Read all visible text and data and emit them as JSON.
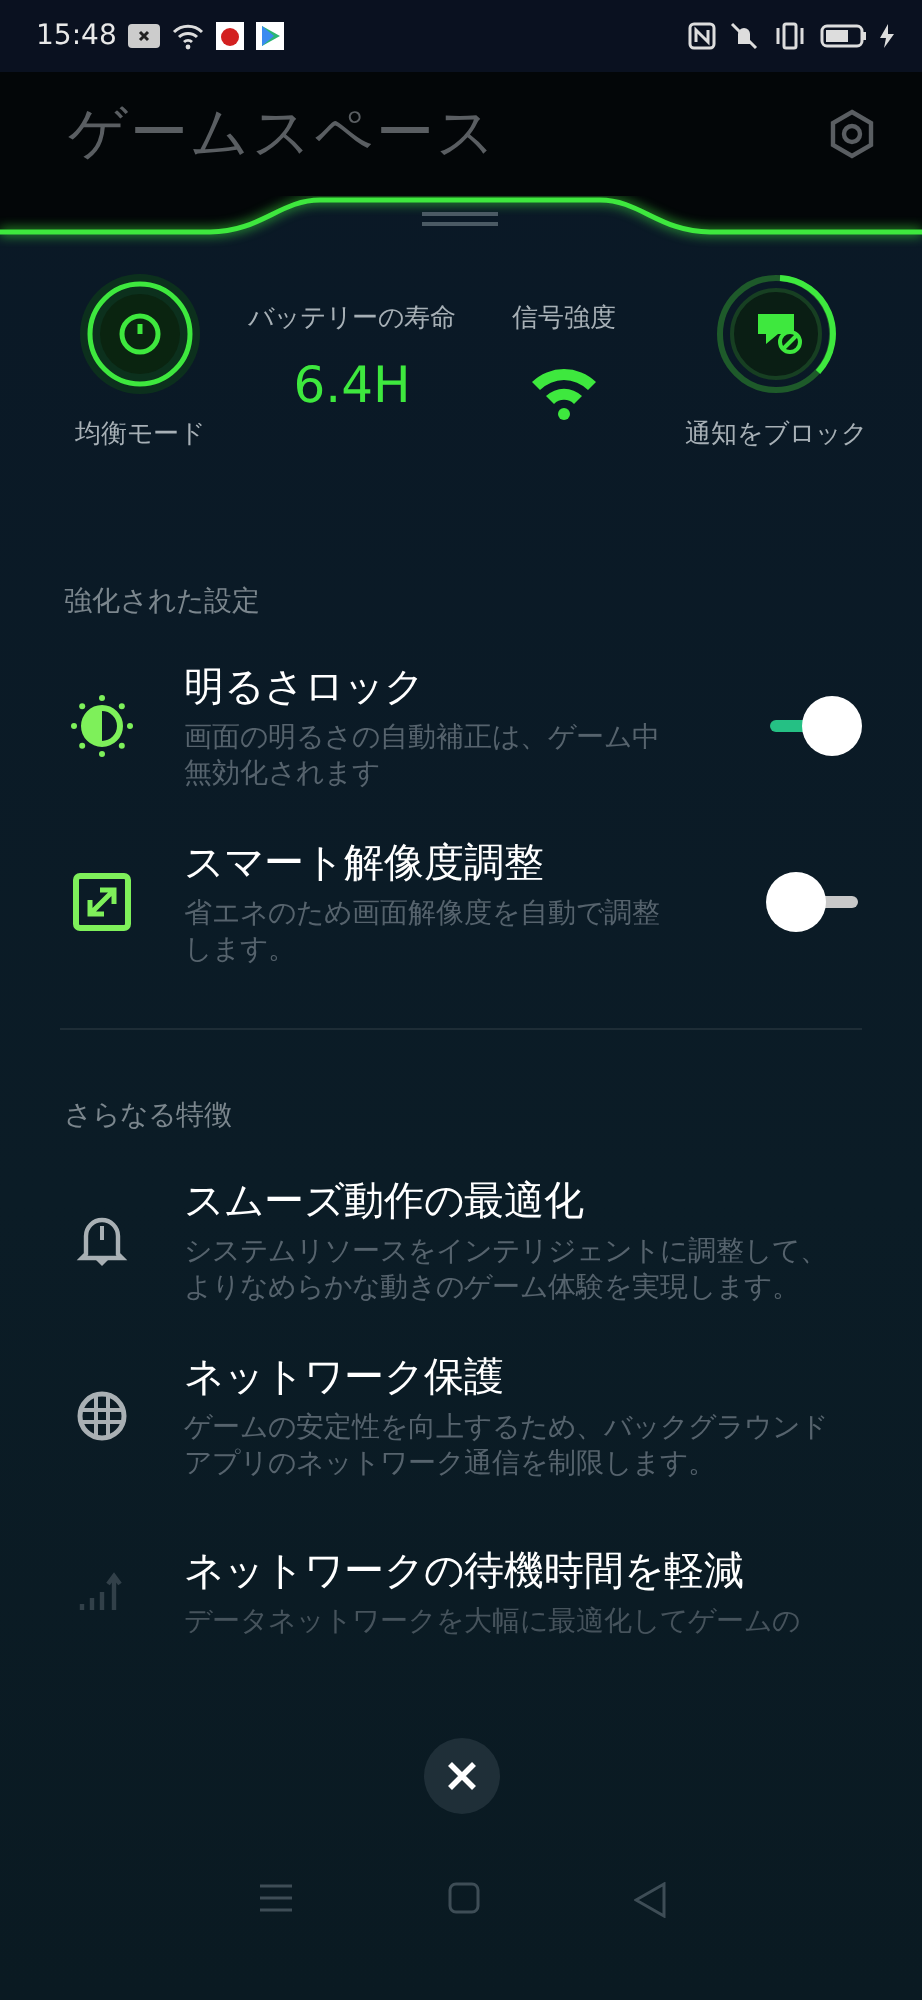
{
  "status_bar": {
    "time": "15:48"
  },
  "header": {
    "title": "ゲームスペース"
  },
  "quick_stats": [
    {
      "kind": "mode",
      "label": "均衡モード"
    },
    {
      "kind": "battery",
      "label": "バッテリーの寿命",
      "value": "6.4H"
    },
    {
      "kind": "signal",
      "label": "信号強度"
    },
    {
      "kind": "block",
      "label": "通知をブロック"
    }
  ],
  "sections": [
    {
      "title": "強化された設定",
      "items": [
        {
          "kind": "toggle",
          "title": "明るさロック",
          "description": "画面の明るさの自動補正は、ゲーム中無効化されます",
          "on": true
        },
        {
          "kind": "toggle",
          "title": "スマート解像度調整",
          "description": "省エネのため画面解像度を自動で調整します。",
          "on": false
        }
      ]
    },
    {
      "title": "さらなる特徴",
      "items": [
        {
          "kind": "feature",
          "title": "スムーズ動作の最適化",
          "description": "システムリソースをインテリジェントに調整して、よりなめらかな動きのゲーム体験を実現します。"
        },
        {
          "kind": "feature",
          "title": "ネットワーク保護",
          "description": "ゲームの安定性を向上するため、バックグラウンドアプリのネットワーク通信を制限します。"
        },
        {
          "kind": "feature",
          "title": "ネットワークの待機時間を軽減",
          "description": "データネットワークを大幅に最適化してゲームの"
        }
      ]
    }
  ]
}
